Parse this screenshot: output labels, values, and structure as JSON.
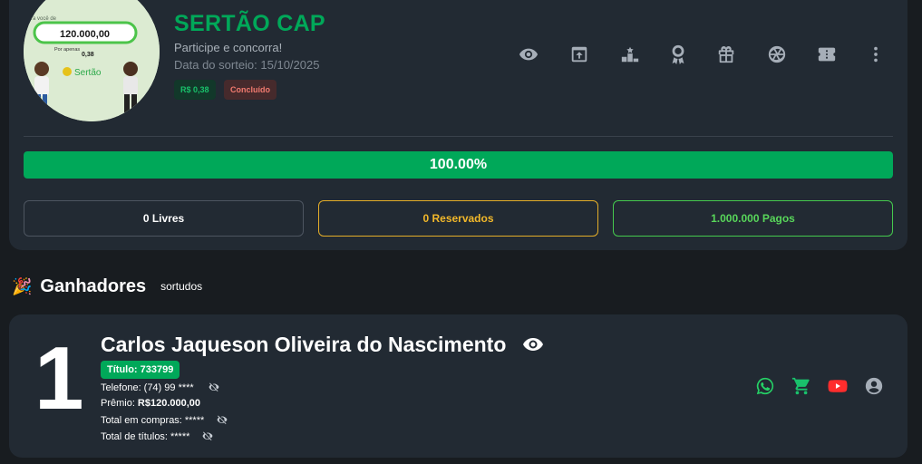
{
  "raffle": {
    "title": "SERTÃO CAP",
    "subtitle": "Participe e concorra!",
    "draw_date": "Data do sorteio: 15/10/2025",
    "price_badge": "R$ 0,38",
    "status_badge": "Concluído",
    "image": {
      "prize_value": "120.000,00",
      "small_text_top": "Pra você de",
      "small_text_mid": "Por apenas",
      "small_price": "0,38",
      "brand": "Sertão"
    }
  },
  "toolbar": {
    "icons": [
      "eye-icon",
      "share-box-icon",
      "podium-icon",
      "award-ribbon-icon",
      "gift-icon",
      "aperture-icon",
      "ticket-icon",
      "more-vertical-icon"
    ]
  },
  "progress": {
    "label": "100.00%",
    "value": 100
  },
  "stats": {
    "free": "0 Livres",
    "reserved": "0 Reservados",
    "paid": "1.000.000 Pagos"
  },
  "winners": {
    "title": "Ganhadores",
    "subtitle": "sortudos",
    "items": [
      {
        "place": "1",
        "name": "Carlos Jaqueson Oliveira do Nascimento",
        "ticket": "Título: 733799",
        "phone_label": "Telefone:",
        "phone": "(74) 99 ****",
        "prize_label": "Prêmio:",
        "prize": "R$120.000,00",
        "purchases_label": "Total em compras:",
        "purchases": "*****",
        "tickets_label": "Total de títulos:",
        "tickets": "*****"
      }
    ]
  },
  "colors": {
    "accent_green": "#00a859",
    "whatsapp": "#25d366",
    "cart": "#19c16b",
    "youtube": "#ff2d2d",
    "reserved": "#f2b82a",
    "paid": "#58d65a"
  }
}
